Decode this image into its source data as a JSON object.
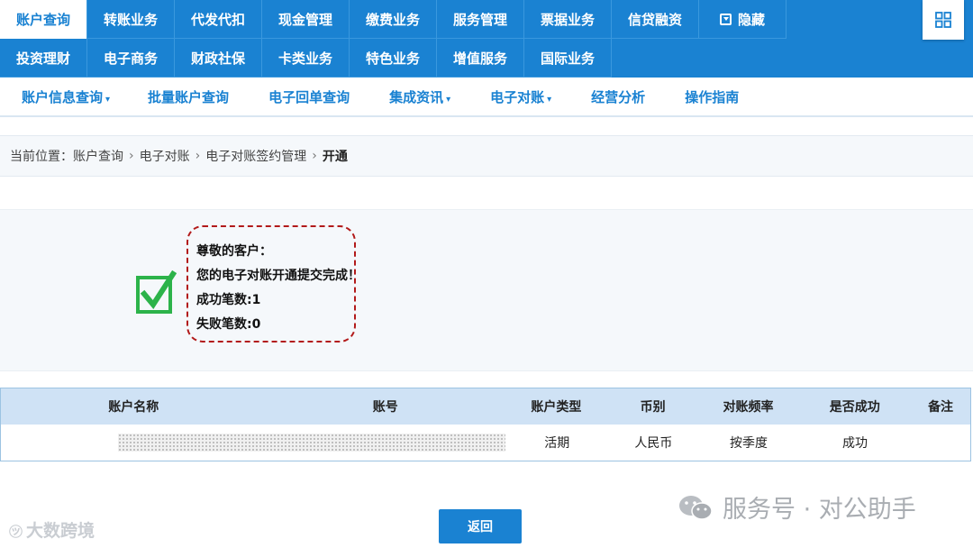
{
  "top_nav": {
    "row1": [
      "账户查询",
      "转账业务",
      "代发代扣",
      "现金管理",
      "缴费业务",
      "服务管理",
      "票据业务",
      "信贷融资"
    ],
    "hide_label": "隐藏",
    "row2": [
      "投资理财",
      "电子商务",
      "财政社保",
      "卡类业务",
      "特色业务",
      "增值服务",
      "国际业务"
    ]
  },
  "sub_nav": [
    "账户信息查询",
    "批量账户查询",
    "电子回单查询",
    "集成资讯",
    "电子对账",
    "经营分析",
    "操作指南"
  ],
  "breadcrumb": {
    "prefix": "当前位置：",
    "items": [
      "账户查询",
      "电子对账",
      "电子对账签约管理"
    ],
    "current": "开通"
  },
  "result": {
    "line1": "尊敬的客户：",
    "line2": "您的电子对账开通提交完成！",
    "line3": "成功笔数:1",
    "line4": "失败笔数:0"
  },
  "table": {
    "headers": [
      "账户名称",
      "账号",
      "账户类型",
      "币别",
      "对账频率",
      "是否成功",
      "备注"
    ],
    "rows": [
      {
        "account_type": "活期",
        "currency": "人民币",
        "frequency": "按季度",
        "success": "成功",
        "note": ""
      }
    ]
  },
  "return_button": "返回",
  "watermark_left": "大数跨境",
  "watermark_right": "服务号 · 对公助手",
  "colors": {
    "primary": "#1a82d2",
    "table_header": "#cfe2f5",
    "panel": "#f5f8fb",
    "highlight": "#b21a1a",
    "check": "#2cb34a"
  }
}
